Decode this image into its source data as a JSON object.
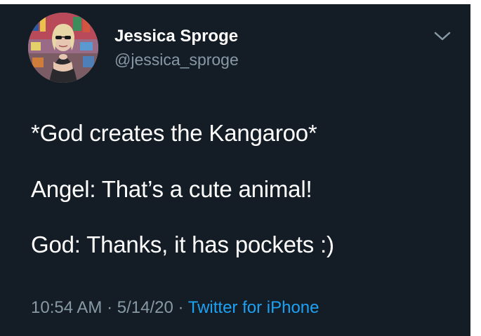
{
  "tweet": {
    "display_name": "Jessica Sproge",
    "handle": "@jessica_sproge",
    "lines": [
      "*God creates the Kangaroo*",
      "Angel: That’s a cute animal!",
      "God: Thanks, it has pockets :)"
    ],
    "time": "10:54 AM",
    "separator": "·",
    "date": "5/14/20",
    "source": "Twitter for iPhone"
  },
  "icons": {
    "avatar": "profile-photo",
    "menu": "chevron-down-icon"
  },
  "colors": {
    "background": "#141d26",
    "text": "#ffffff",
    "muted": "#8899a6",
    "link": "#1da1f2"
  }
}
